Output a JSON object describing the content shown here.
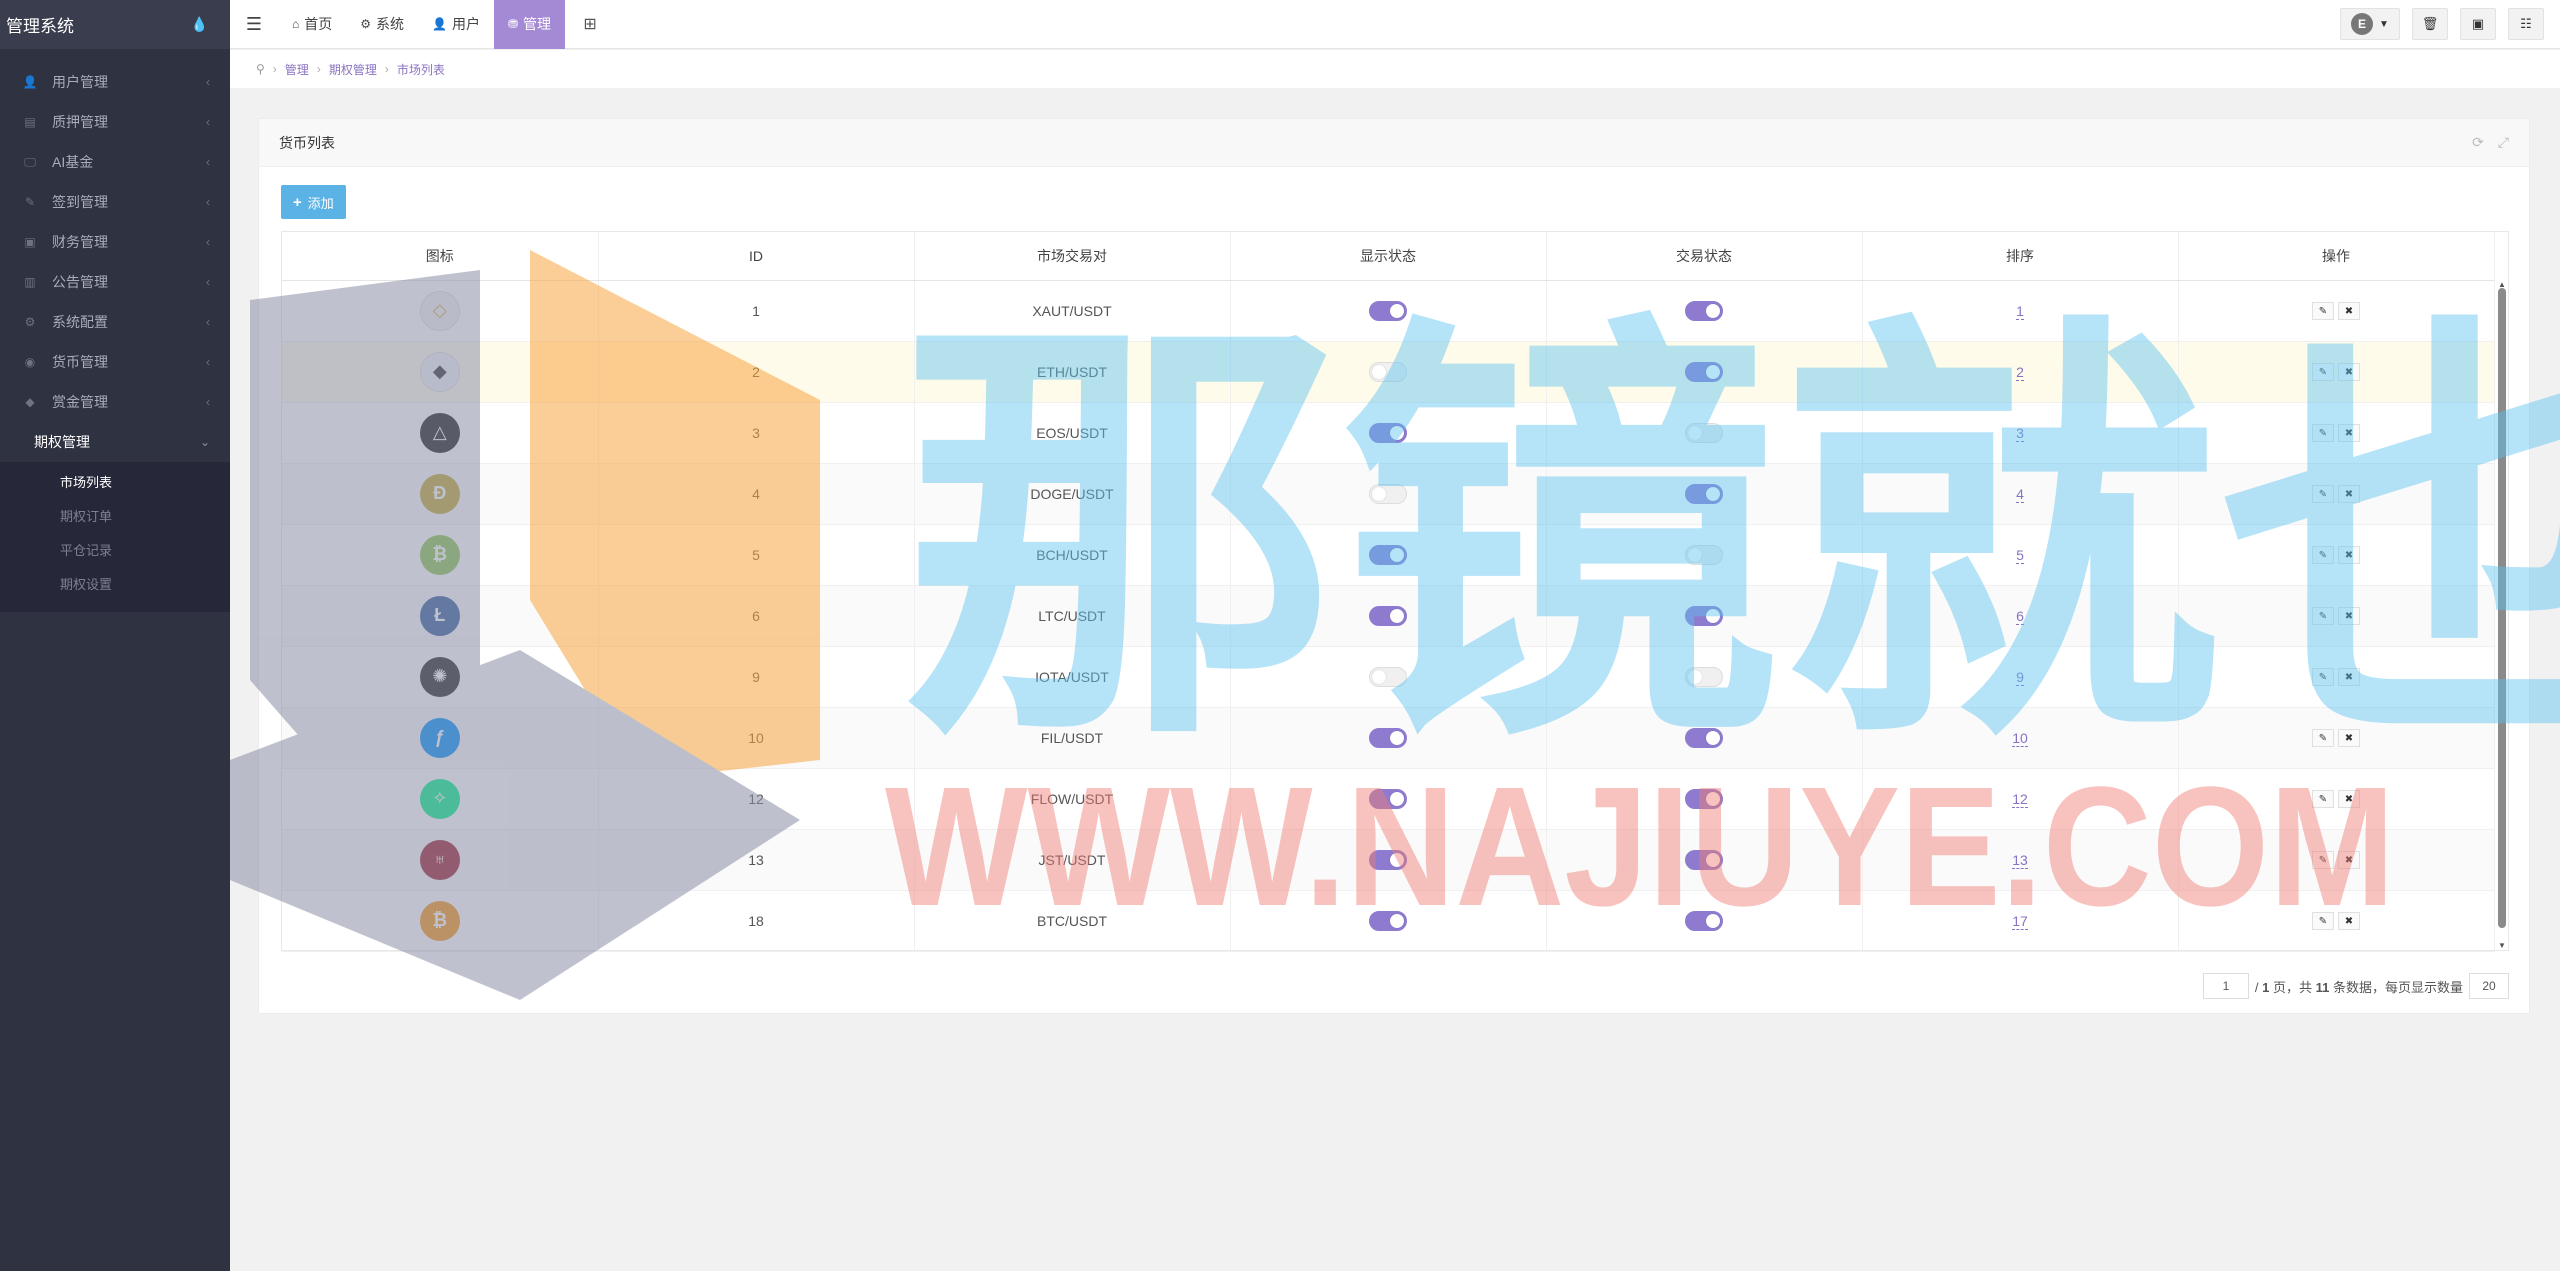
{
  "sidebar": {
    "title": "管理系统",
    "items": [
      {
        "label": "用户管理",
        "icon": "user-icon",
        "glyph": "👤"
      },
      {
        "label": "质押管理",
        "icon": "pledge-icon",
        "glyph": "▤"
      },
      {
        "label": "AI基金",
        "icon": "monitor-icon",
        "glyph": "🖵"
      },
      {
        "label": "签到管理",
        "icon": "edit-icon",
        "glyph": "✎"
      },
      {
        "label": "财务管理",
        "icon": "money-icon",
        "glyph": "▣"
      },
      {
        "label": "公告管理",
        "icon": "notice-icon",
        "glyph": "▥"
      },
      {
        "label": "系统配置",
        "icon": "gears-icon",
        "glyph": "⚙"
      },
      {
        "label": "货币管理",
        "icon": "coin-icon",
        "glyph": "◉"
      },
      {
        "label": "赏金管理",
        "icon": "bounty-icon",
        "glyph": "◆"
      }
    ],
    "open_item": "期权管理",
    "sub_items": [
      "市场列表",
      "期权订单",
      "平仓记录",
      "期权设置"
    ]
  },
  "navbar": {
    "tabs": [
      {
        "label": "首页",
        "glyph": "⌂"
      },
      {
        "label": "系统",
        "glyph": "⚙"
      },
      {
        "label": "用户",
        "glyph": "👤"
      },
      {
        "label": "管理",
        "glyph": "⛃"
      }
    ],
    "avatar_letter": "E"
  },
  "breadcrumb": [
    "管理",
    "期权管理",
    "市场列表"
  ],
  "panel": {
    "title": "货币列表",
    "add_label": "添加"
  },
  "table": {
    "headers": [
      "图标",
      "ID",
      "市场交易对",
      "显示状态",
      "交易状态",
      "排序",
      "操作"
    ],
    "rows": [
      {
        "id": "1",
        "pair": "XAUT/USDT",
        "show": true,
        "trade": true,
        "sort": "1",
        "coin": "gold-icon",
        "color": "#f2f2f2",
        "glyph": "◇",
        "fg": "#d2a84a"
      },
      {
        "id": "2",
        "pair": "ETH/USDT",
        "show": false,
        "trade": true,
        "sort": "2",
        "coin": "eth-icon",
        "color": "#eef0f7",
        "glyph": "◆",
        "fg": "#333"
      },
      {
        "id": "3",
        "pair": "EOS/USDT",
        "show": true,
        "trade": false,
        "sort": "3",
        "coin": "eos-icon",
        "color": "#1b1b1b",
        "glyph": "△",
        "fg": "#fff"
      },
      {
        "id": "4",
        "pair": "DOGE/USDT",
        "show": false,
        "trade": true,
        "sort": "4",
        "coin": "doge-icon",
        "color": "#c2a633",
        "glyph": "Ð",
        "fg": "#fff"
      },
      {
        "id": "5",
        "pair": "BCH/USDT",
        "show": true,
        "trade": false,
        "sort": "5",
        "coin": "bch-icon",
        "color": "#8dc351",
        "glyph": "₿",
        "fg": "#fff"
      },
      {
        "id": "6",
        "pair": "LTC/USDT",
        "show": true,
        "trade": true,
        "sort": "6",
        "coin": "ltc-icon",
        "color": "#345d9d",
        "glyph": "Ł",
        "fg": "#fff"
      },
      {
        "id": "9",
        "pair": "IOTA/USDT",
        "show": false,
        "trade": false,
        "sort": "9",
        "coin": "iota-icon",
        "color": "#242424",
        "glyph": "✺",
        "fg": "#fff"
      },
      {
        "id": "10",
        "pair": "FIL/USDT",
        "show": true,
        "trade": true,
        "sort": "10",
        "coin": "fil-icon",
        "color": "#0090ff",
        "glyph": "ƒ",
        "fg": "#fff"
      },
      {
        "id": "12",
        "pair": "FLOW/USDT",
        "show": true,
        "trade": true,
        "sort": "12",
        "coin": "flow-icon",
        "color": "#00ef8b",
        "glyph": "✧",
        "fg": "#fff"
      },
      {
        "id": "13",
        "pair": "JST/USDT",
        "show": true,
        "trade": true,
        "sort": "13",
        "coin": "jst-icon",
        "color": "#9b1c2e",
        "glyph": "♅",
        "fg": "#fff"
      },
      {
        "id": "18",
        "pair": "BTC/USDT",
        "show": true,
        "trade": true,
        "sort": "17",
        "coin": "btc-icon",
        "color": "#f7931a",
        "glyph": "₿",
        "fg": "#fff"
      }
    ]
  },
  "pagination": {
    "page": "1",
    "summary_pre": "/ ",
    "total_pages": "1",
    "summary_mid": " 页，共 ",
    "total_records": "11",
    "summary_post": " 条数据，每页显示数量",
    "page_size": "20"
  },
  "watermark": {
    "cn_text": "那镜就也",
    "url_text": "WWW.NAJIUYE.COM"
  }
}
